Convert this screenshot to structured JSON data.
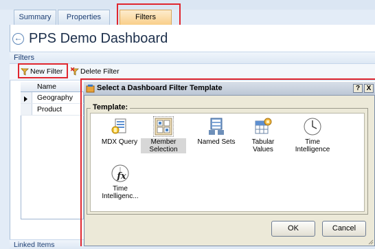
{
  "tabs": [
    {
      "label": "Summary"
    },
    {
      "label": "Properties"
    },
    {
      "label": "Filters"
    }
  ],
  "page": {
    "title": "PPS Demo Dashboard"
  },
  "filters_panel": {
    "header": "Filters"
  },
  "toolbar": {
    "new_filter": "New Filter",
    "delete_filter": "Delete Filter"
  },
  "grid": {
    "column": "Name",
    "rows": [
      {
        "name": "Geography"
      },
      {
        "name": "Product"
      }
    ]
  },
  "linked_items": {
    "header": "Linked Items"
  },
  "dialog": {
    "title": "Select a Dashboard Filter Template",
    "help": "?",
    "close": "X",
    "group_label": "Template:",
    "templates": [
      {
        "label": "MDX Query",
        "icon": "mdx-query-icon"
      },
      {
        "label": "Member Selection",
        "icon": "member-selection-icon",
        "selected": true
      },
      {
        "label": "Named Sets",
        "icon": "named-sets-icon"
      },
      {
        "label": "Tabular Values",
        "icon": "tabular-values-icon"
      },
      {
        "label": "Time Intelligence",
        "icon": "time-intelligence-icon"
      },
      {
        "label": "Time Intelligenc...",
        "icon": "time-intelligence-formula-icon"
      }
    ],
    "ok": "OK",
    "cancel": "Cancel"
  },
  "colors": {
    "highlight_border": "#e0262e",
    "active_tab": "#f9cf8a"
  }
}
